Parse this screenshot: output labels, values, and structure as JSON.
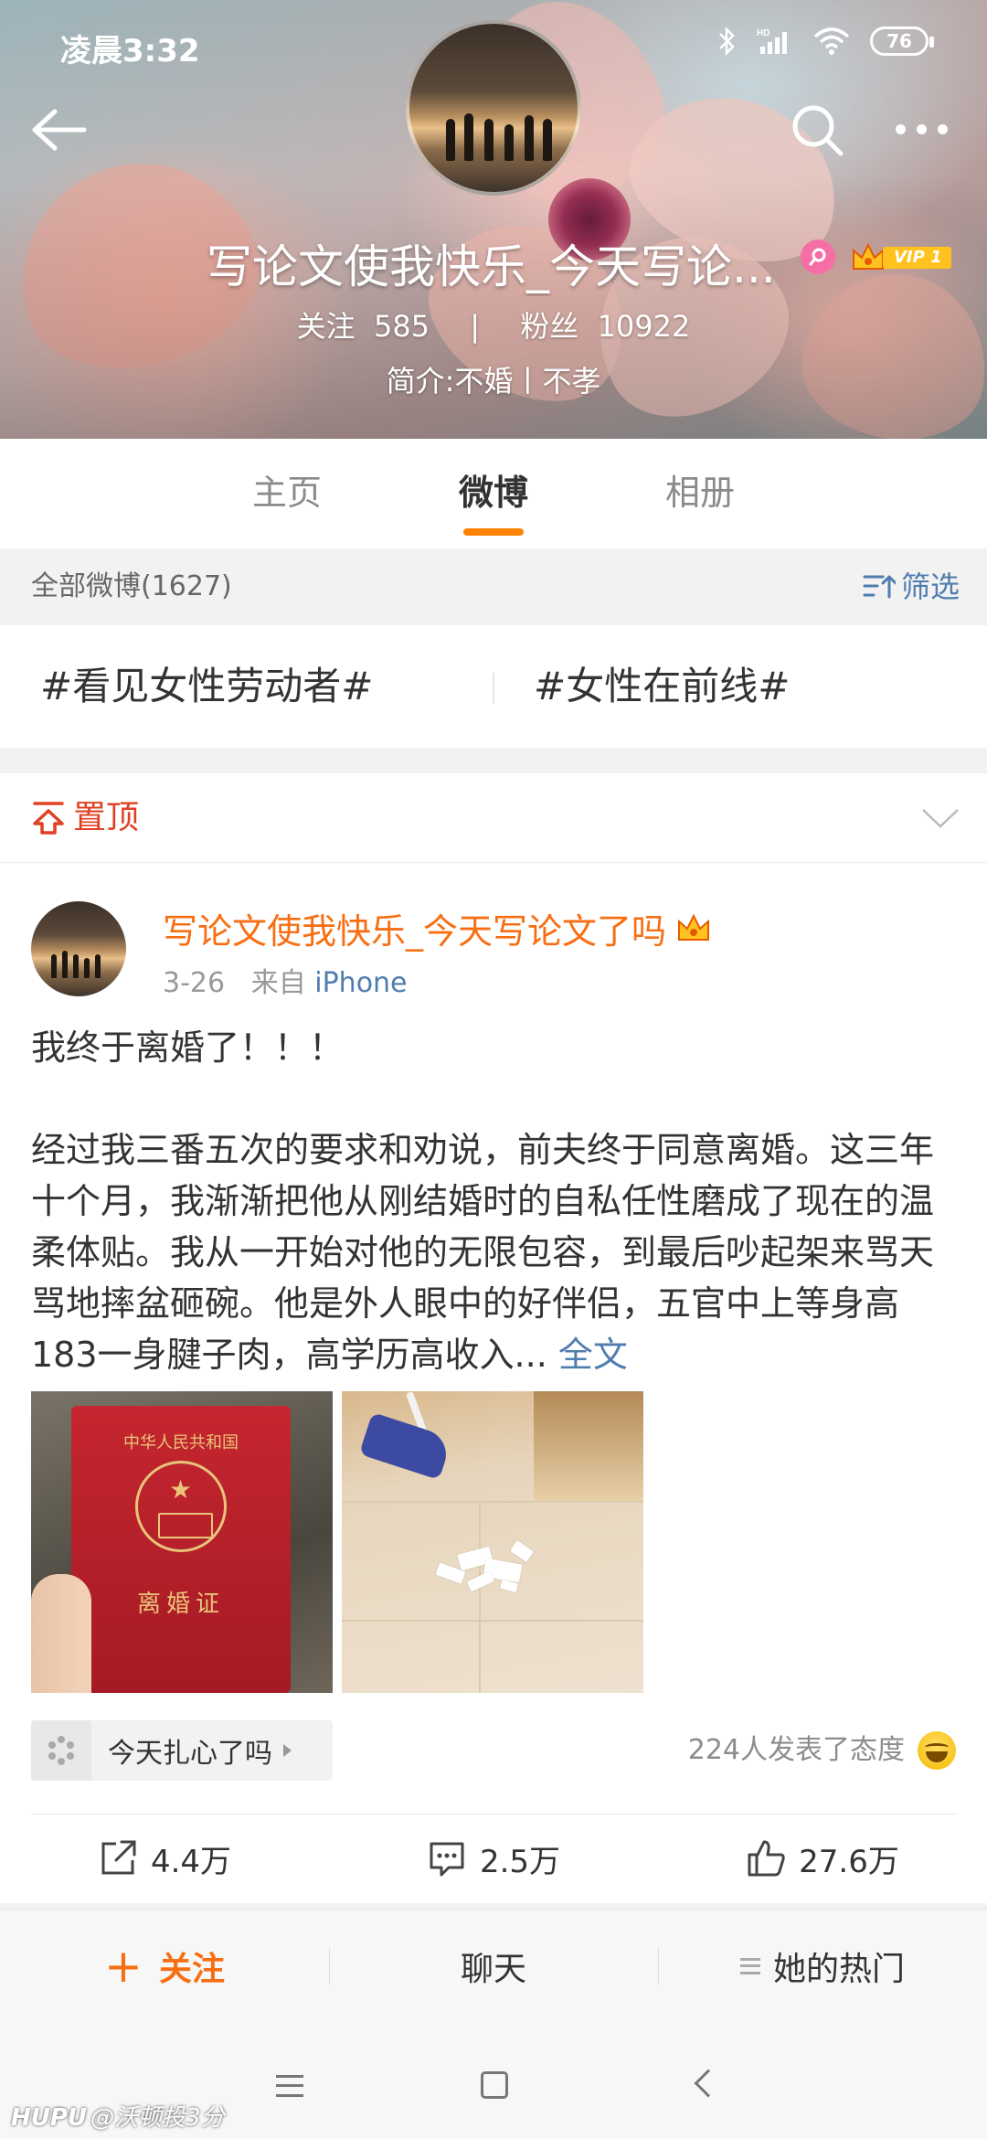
{
  "status_bar": {
    "time": "凌晨3:32",
    "battery": "76",
    "icons": [
      "bluetooth-icon",
      "hd-signal-icon",
      "wifi-icon",
      "battery-icon"
    ]
  },
  "header": {
    "name": "写论文使我快乐_今天写论...",
    "vip_label": "VIP 1",
    "following_label": "关注",
    "following_count": "585",
    "followers_label": "粉丝",
    "followers_count": "10922",
    "bio": "简介:不婚丨不孝"
  },
  "tabs": [
    {
      "label": "主页",
      "active": false
    },
    {
      "label": "微博",
      "active": true
    },
    {
      "label": "相册",
      "active": false
    }
  ],
  "filter": {
    "all_posts": "全部微博(1627)",
    "filter_label": "筛选"
  },
  "topics": [
    "#看见女性劳动者#",
    "#女性在前线#"
  ],
  "pinned": {
    "label": "置顶"
  },
  "post": {
    "author": "写论文使我快乐_今天写论文了吗",
    "date": "3-26",
    "source_prefix": "来自",
    "source": "iPhone",
    "text_line1": "我终于离婚了！！！",
    "text_body": "经过我三番五次的要求和劝说，前夫终于同意离婚。这三年十个月，我渐渐把他从刚结婚时的自私任性磨成了现在的温柔体贴。我从一开始对他的无限包容，到最后吵起架来骂天骂地摔盆砸碗。他是外人眼中的好伴侣，五官中上等身高183一身腱子肉，高学历高收入...",
    "more_link": "全文",
    "photo1": {
      "title": "中华人民共和国",
      "name": "离婚证"
    },
    "topic_chip": "今天扎心了吗",
    "attitude_count": "224人发表了态度",
    "reposts": "4.4万",
    "comments": "2.5万",
    "likes": "27.6万"
  },
  "bottom_bar": {
    "follow": "关注",
    "chat": "聊天",
    "hot": "她的热门"
  },
  "watermark": {
    "brand": "HUPU",
    "user": "@沃顿投3分"
  },
  "colors": {
    "accent_orange": "#ff8200",
    "link_blue": "#507daf",
    "name_orange": "#f86f13",
    "pinned_red": "#e14123"
  }
}
